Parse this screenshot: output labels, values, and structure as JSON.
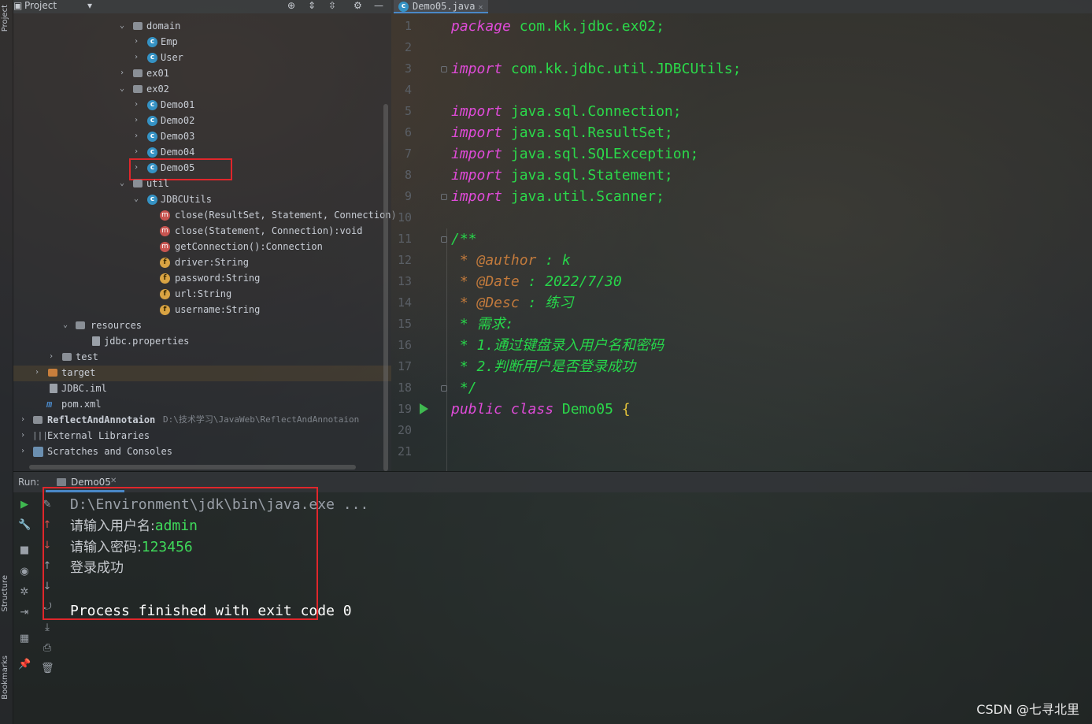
{
  "sidebar": {
    "project_label": "Project",
    "structure_label": "Structure",
    "bookmarks_label": "Bookmarks"
  },
  "project_panel": {
    "title": "Project",
    "tree": [
      {
        "label": "domain",
        "type": "folder",
        "expanded": true
      },
      {
        "label": "Emp",
        "type": "class"
      },
      {
        "label": "User",
        "type": "class"
      },
      {
        "label": "ex01",
        "type": "folder",
        "expanded": false
      },
      {
        "label": "ex02",
        "type": "folder",
        "expanded": true
      },
      {
        "label": "Demo01",
        "type": "class"
      },
      {
        "label": "Demo02",
        "type": "class"
      },
      {
        "label": "Demo03",
        "type": "class"
      },
      {
        "label": "Demo04",
        "type": "class"
      },
      {
        "label": "Demo05",
        "type": "class",
        "highlighted": true
      },
      {
        "label": "util",
        "type": "folder",
        "expanded": true
      },
      {
        "label": "JDBCUtils",
        "type": "class",
        "expanded": true
      },
      {
        "label": "close(ResultSet, Statement, Connection)",
        "type": "method"
      },
      {
        "label": "close(Statement, Connection):void",
        "type": "method"
      },
      {
        "label": "getConnection():Connection",
        "type": "method"
      },
      {
        "label": "driver:String",
        "type": "field"
      },
      {
        "label": "password:String",
        "type": "field"
      },
      {
        "label": "url:String",
        "type": "field"
      },
      {
        "label": "username:String",
        "type": "field"
      },
      {
        "label": "resources",
        "type": "folder",
        "expanded": true
      },
      {
        "label": "jdbc.properties",
        "type": "file"
      },
      {
        "label": "test",
        "type": "folder",
        "expanded": false
      },
      {
        "label": "target",
        "type": "folder-orange",
        "expanded": false
      },
      {
        "label": "JDBC.iml",
        "type": "file"
      },
      {
        "label": "pom.xml",
        "type": "maven"
      },
      {
        "label": "ReflectAndAnnotaion",
        "type": "module",
        "path": "D:\\技术学习\\JavaWeb\\ReflectAndAnnotaion"
      },
      {
        "label": "External Libraries",
        "type": "library"
      },
      {
        "label": "Scratches and Consoles",
        "type": "scratch"
      }
    ]
  },
  "editor": {
    "tab_label": "Demo05.java",
    "line_numbers": [
      "1",
      "2",
      "3",
      "4",
      "5",
      "6",
      "7",
      "8",
      "9",
      "10",
      "11",
      "12",
      "13",
      "14",
      "15",
      "16",
      "17",
      "18",
      "19",
      "20",
      "21"
    ],
    "code": {
      "l1_kw": "package",
      "l1_rest": " com.kk.jdbc.ex02;",
      "l3_kw": "import",
      "l3_rest": " com.kk.jdbc.util.JDBCUtils;",
      "l5_kw": "import",
      "l5_rest": " java.sql.Connection;",
      "l6_kw": "import",
      "l6_rest": " java.sql.ResultSet;",
      "l7_kw": "import",
      "l7_rest": " java.sql.SQLException;",
      "l8_kw": "import",
      "l8_rest": " java.sql.Statement;",
      "l9_kw": "import",
      "l9_rest": " java.util.Scanner;",
      "l11": "/**",
      "l12_tag": " * @author",
      "l12_rest": " : k",
      "l13_tag": " * @Date",
      "l13_rest": " : 2022/7/30",
      "l14_tag": " * @Desc",
      "l14_rest": " : 练习",
      "l15": " * 需求:",
      "l16": " * 1.通过键盘录入用户名和密码",
      "l17": " * 2.判断用户是否登录成功",
      "l18": " */",
      "l19_kw": "public class",
      "l19_name": " Demo05",
      "l19_brace": " {"
    }
  },
  "run_panel": {
    "label": "Run:",
    "tab_label": "Demo05",
    "console": {
      "line1": "D:\\Environment\\jdk\\bin\\java.exe ...",
      "line2_prompt": "请输入用户名:",
      "line2_value": "admin",
      "line3_prompt": "请输入密码:",
      "line3_value": "123456",
      "line4": "登录成功",
      "line6": "Process finished with exit code 0"
    }
  },
  "watermark": "CSDN @七寻北里"
}
